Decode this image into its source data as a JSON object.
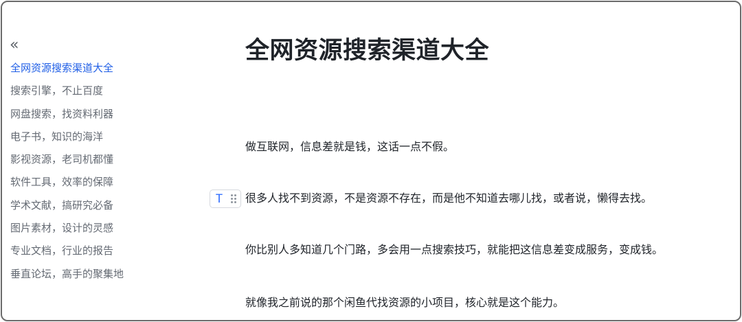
{
  "sidebar": {
    "collapse_glyph": "«",
    "items": [
      {
        "label": "全网资源搜索渠道大全"
      },
      {
        "label": "搜索引擎，不止百度"
      },
      {
        "label": "网盘搜索，找资料利器"
      },
      {
        "label": "电子书，知识的海洋"
      },
      {
        "label": "影视资源，老司机都懂"
      },
      {
        "label": "软件工具，效率的保障"
      },
      {
        "label": "学术文献，搞研究必备"
      },
      {
        "label": "图片素材，设计的灵感"
      },
      {
        "label": "专业文档，行业的报告"
      },
      {
        "label": "垂直论坛，高手的聚集地"
      }
    ],
    "active_color": "#1f5ee6"
  },
  "document": {
    "title": "全网资源搜索渠道大全",
    "paragraphs": [
      "做互联网，信息差就是钱，这话一点不假。",
      "很多人找不到资源，不是资源不存在，而是他不知道去哪儿找，或者说，懒得去找。",
      "你比别人多知道几个门路，多会用一点搜索技巧，就能把这信息差变成服务，变成钱。",
      "就像我之前说的那个闲鱼代找资源的小项目，核心就是这个能力。"
    ]
  },
  "block_handle": {
    "type_glyph": "T",
    "icons": [
      "text-type-icon",
      "drag-handle-icon"
    ]
  }
}
